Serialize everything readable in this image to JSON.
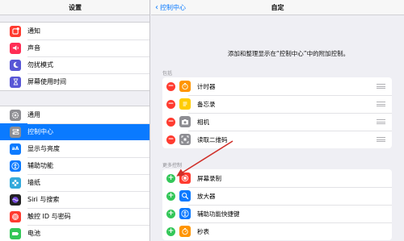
{
  "sidebar": {
    "title": "设置",
    "groups": [
      {
        "items": [
          {
            "label": "通知",
            "icon": "notifications-icon",
            "color": "#ff3b30"
          },
          {
            "label": "声音",
            "icon": "sounds-icon",
            "color": "#ff2d55"
          },
          {
            "label": "勿扰模式",
            "icon": "do-not-disturb-icon",
            "color": "#5856d6"
          },
          {
            "label": "屏幕使用时间",
            "icon": "screen-time-icon",
            "color": "#5856d6"
          }
        ]
      },
      {
        "items": [
          {
            "label": "通用",
            "icon": "general-icon",
            "color": "#8e8e93"
          },
          {
            "label": "控制中心",
            "icon": "control-center-icon",
            "color": "#8e8e93",
            "selected": true
          },
          {
            "label": "显示与亮度",
            "icon": "display-brightness-icon",
            "color": "#0a7aff"
          },
          {
            "label": "辅助功能",
            "icon": "accessibility-icon",
            "color": "#0a7aff"
          },
          {
            "label": "墙纸",
            "icon": "wallpaper-icon",
            "color": "#34aadc"
          },
          {
            "label": "Siri 与搜索",
            "icon": "siri-icon",
            "color": "#222222"
          },
          {
            "label": "触控 ID 与密码",
            "icon": "touch-id-icon",
            "color": "#ff3b30"
          },
          {
            "label": "电池",
            "icon": "battery-icon",
            "color": "#34c759"
          }
        ]
      }
    ]
  },
  "nav": {
    "back_label": "控制中心",
    "title": "自定"
  },
  "description": "添加和整理显示在“控制中心”中的附加控制。",
  "include": {
    "header": "包括",
    "items": [
      {
        "label": "计时器",
        "icon": "timer-icon",
        "color": "#ff9500"
      },
      {
        "label": "备忘录",
        "icon": "notes-icon",
        "color": "#ffcc00"
      },
      {
        "label": "相机",
        "icon": "camera-icon",
        "color": "#8e8e93"
      },
      {
        "label": "读取二维码",
        "icon": "qr-code-icon",
        "color": "#8e8e93"
      }
    ]
  },
  "more": {
    "header": "更多控制",
    "items": [
      {
        "label": "屏幕录制",
        "icon": "screen-recording-icon",
        "color": "#ff3b30"
      },
      {
        "label": "放大器",
        "icon": "magnifier-icon",
        "color": "#0a7aff"
      },
      {
        "label": "辅助功能快捷键",
        "icon": "accessibility-shortcut-icon",
        "color": "#0a7aff"
      },
      {
        "label": "秒表",
        "icon": "stopwatch-icon",
        "color": "#ff9500"
      }
    ]
  },
  "colors": {
    "accent": "#0a7aff",
    "remove": "#ff3b30",
    "add": "#34c759",
    "annotation_arrow": "#d0302a"
  }
}
